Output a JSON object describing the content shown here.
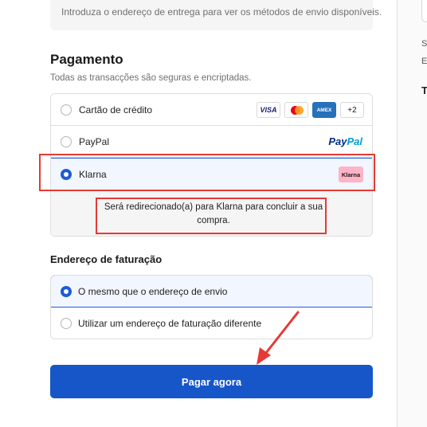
{
  "shipping": {
    "notice": "Introduza o endereço de entrega para ver os métodos de envio disponíveis."
  },
  "payment": {
    "title": "Pagamento",
    "subtitle": "Todas as transacções são seguras e encriptadas.",
    "options": [
      {
        "label": "Cartão de crédito",
        "selected": false
      },
      {
        "label": "PayPal",
        "selected": false
      },
      {
        "label": "Klarna",
        "selected": true
      }
    ],
    "card_brands": {
      "visa": "VISA",
      "amex": "AMEX",
      "more": "+2"
    },
    "paypal_logo": {
      "part1": "Pay",
      "part2": "Pal"
    },
    "klarna_badge": "Klarna",
    "redirect_text": "Será redirecionado(a) para Klarna para concluir a sua compra."
  },
  "billing": {
    "title": "Endereço de faturação",
    "options": [
      {
        "label": "O mesmo que o endereço de envio",
        "selected": true
      },
      {
        "label": "Utilizar um endereço de faturação diferente",
        "selected": false
      }
    ]
  },
  "pay_button": {
    "label": "Pagar agora"
  },
  "sidebar": {
    "line1": "S",
    "line2": "E",
    "line3": "T"
  },
  "colors": {
    "accent": "#1756c9",
    "annotation": "#e53935",
    "klarna_pink": "#ffb3c7"
  },
  "icons": [
    "visa-icon",
    "mastercard-icon",
    "amex-icon",
    "paypal-logo",
    "klarna-logo",
    "arrow-annotation"
  ]
}
